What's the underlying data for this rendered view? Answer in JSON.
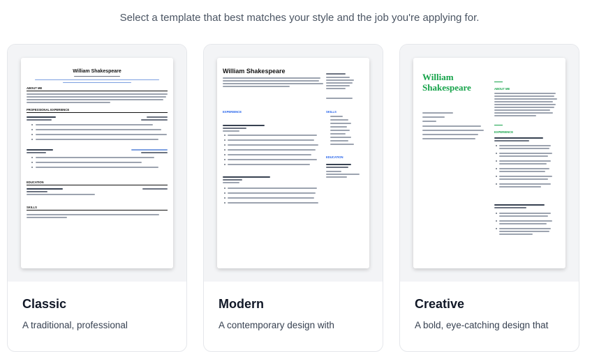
{
  "header": {
    "subtitle": "Select a template that best matches your style and the job you're applying for."
  },
  "templates": [
    {
      "title": "Classic",
      "description": "A traditional, professional",
      "resume": {
        "name": "William Shakespeare",
        "section_about": "ABOUT ME",
        "section_experience": "PROFESSIONAL EXPERIENCE",
        "section_education": "EDUCATION",
        "section_skills": "SKILLS"
      }
    },
    {
      "title": "Modern",
      "description": "A contemporary design with",
      "resume": {
        "name": "William Shakespeare",
        "section_experience": "EXPERIENCE",
        "section_skills": "SKILLS",
        "section_education": "EDUCATION"
      }
    },
    {
      "title": "Creative",
      "description": "A bold, eye-catching design that",
      "resume": {
        "name_line1": "William",
        "name_line2": "Shakespeare",
        "section_about": "ABOUT ME",
        "section_experience": "EXPERIENCE",
        "accent_color": "#16a34a"
      }
    }
  ]
}
